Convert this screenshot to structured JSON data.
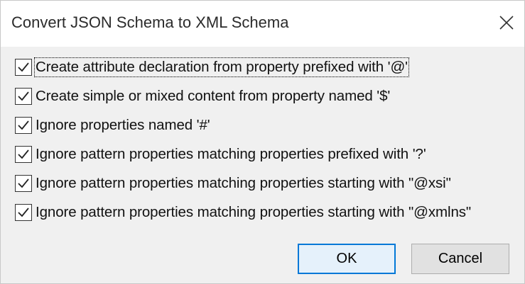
{
  "window": {
    "title": "Convert JSON Schema to XML Schema",
    "close_icon": "close-icon"
  },
  "options": [
    {
      "label": "Create attribute declaration from property prefixed with '@'",
      "checked": true,
      "focused": true
    },
    {
      "label": "Create simple or mixed content from property named '$'",
      "checked": true
    },
    {
      "label": "Ignore properties named '#'",
      "checked": true
    },
    {
      "label": "Ignore pattern properties matching properties prefixed with '?'",
      "checked": true
    },
    {
      "label": "Ignore pattern properties matching properties starting with \"@xsi\"",
      "checked": true
    },
    {
      "label": "Ignore pattern properties matching properties starting with \"@xmlns\"",
      "checked": true
    }
  ],
  "buttons": {
    "ok_label": "OK",
    "cancel_label": "Cancel"
  },
  "colors": {
    "accent": "#0078d7",
    "dialog_bg": "#f0f0f0",
    "titlebar_bg": "#ffffff"
  }
}
